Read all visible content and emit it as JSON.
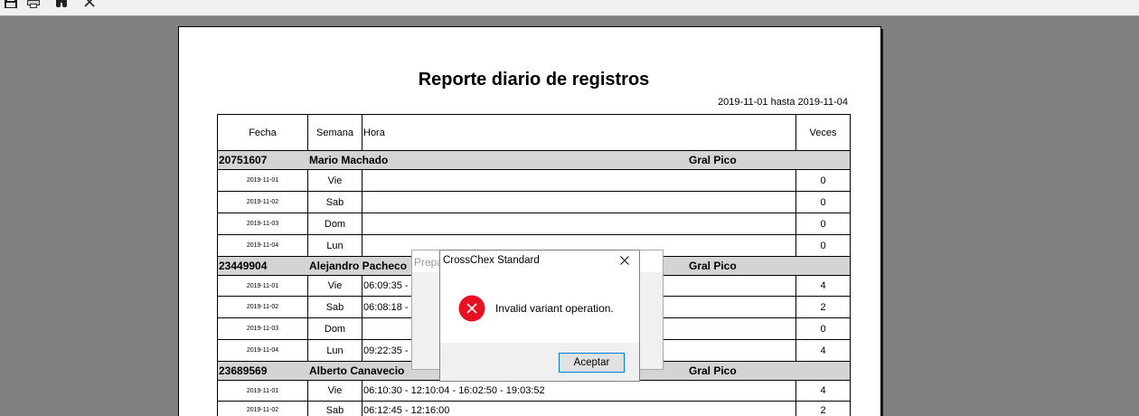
{
  "toolbar": {
    "icons": [
      "save-icon",
      "print-icon",
      "binoculars-icon",
      "close-icon"
    ]
  },
  "report": {
    "title": "Reporte diario de registros",
    "date_range": "2019-11-01 hasta 2019-11-04",
    "columns": {
      "fecha": "Fecha",
      "semana": "Semana",
      "hora": "Hora",
      "veces": "Veces"
    },
    "groups": [
      {
        "id": "20751607",
        "name": "Mario Machado",
        "location": "Gral Pico",
        "rows": [
          {
            "fecha": "2019-11-01",
            "semana": "Vie",
            "hora": "",
            "veces": "0"
          },
          {
            "fecha": "2019-11-02",
            "semana": "Sab",
            "hora": "",
            "veces": "0"
          },
          {
            "fecha": "2019-11-03",
            "semana": "Dom",
            "hora": "",
            "veces": "0"
          },
          {
            "fecha": "2019-11-04",
            "semana": "Lun",
            "hora": "",
            "veces": "0"
          }
        ]
      },
      {
        "id": "23449904",
        "name": "Alejandro Pacheco",
        "location": "Gral Pico",
        "rows": [
          {
            "fecha": "2019-11-01",
            "semana": "Vie",
            "hora": "06:09:35 -",
            "veces": "4"
          },
          {
            "fecha": "2019-11-02",
            "semana": "Sab",
            "hora": "06:08:18 -",
            "veces": "2"
          },
          {
            "fecha": "2019-11-03",
            "semana": "Dom",
            "hora": "",
            "veces": "0"
          },
          {
            "fecha": "2019-11-04",
            "semana": "Lun",
            "hora": "09:22:35 -",
            "veces": "4"
          }
        ]
      },
      {
        "id": "23689569",
        "name": "Alberto Canavecio",
        "location": "Gral Pico",
        "rows": [
          {
            "fecha": "2019-11-01",
            "semana": "Vie",
            "hora": "06:10:30 - 12:10:04 - 16:02:50 - 19:03:52",
            "veces": "4"
          },
          {
            "fecha": "2019-11-02",
            "semana": "Sab",
            "hora": "06:12:45 - 12:16:00",
            "veces": "2"
          }
        ]
      }
    ]
  },
  "background_dialog": {
    "title": "Prepa"
  },
  "error_dialog": {
    "title": "CrossChex Standard",
    "icon": "error-icon",
    "close_icon": "close-icon",
    "message": "Invalid variant operation.",
    "ok_button": "Aceptar"
  },
  "colors": {
    "workspace": "#808080",
    "group_row": "#d4d4d4",
    "error_red": "#e81123",
    "button_focus_border": "#0078d7"
  }
}
